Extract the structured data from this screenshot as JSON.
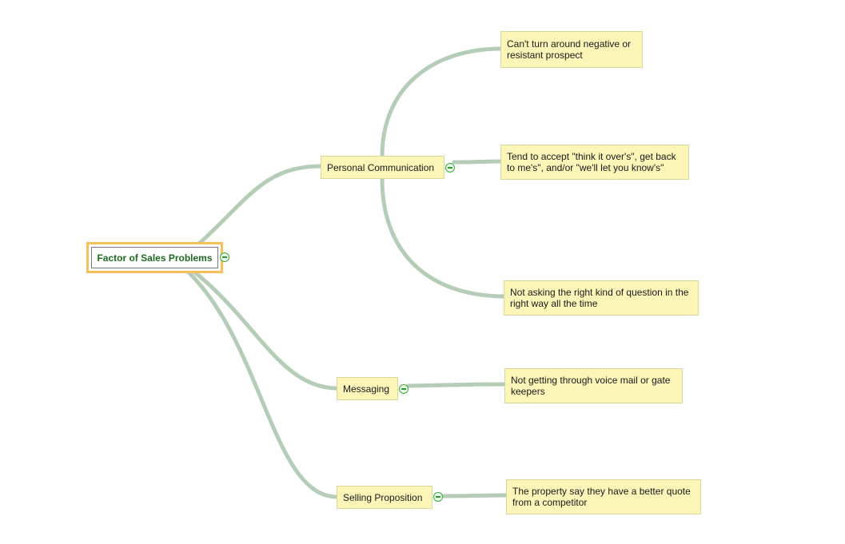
{
  "map": {
    "root": {
      "label": "Factor of Sales Problems",
      "selected": true,
      "collapsible": true
    },
    "branches": [
      {
        "label": "Personal Communication",
        "children": [
          {
            "label": "Can't turn around negative or\nresistant prospect"
          },
          {
            "label": "Tend  to accept \"think it over's\", get back\nto me's\", and/or \"we'll let you know's\""
          },
          {
            "label": "Not asking the right kind of question in the\nright way all the time"
          }
        ]
      },
      {
        "label": "Messaging",
        "children": [
          {
            "label": "Not getting through voice mail or gate\nkeepers"
          }
        ]
      },
      {
        "label": "Selling Proposition",
        "children": [
          {
            "label": "The property say they have a better quote\nfrom a competitor"
          }
        ]
      }
    ]
  },
  "colors": {
    "connector": "#b5cdb7",
    "node_fill": "#fcf5b8",
    "root_highlight": "#f9bd59",
    "root_text": "#1f6a1f",
    "toggle": "#3aae3a"
  },
  "icons": {
    "toggle": "collapse-minus-icon"
  }
}
